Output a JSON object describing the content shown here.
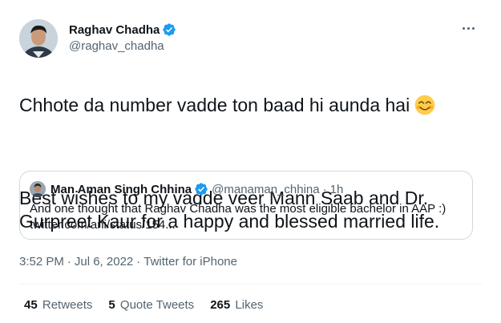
{
  "author": {
    "name": "Raghav Chadha",
    "handle": "@raghav_chadha"
  },
  "tweet": {
    "line1": "Chhote da number vadde ton baad hi aunda hai",
    "line2": "Best wishes to my vadde veer Mann Saab and Dr. Gurpreet Kaur for a happy and blessed married life."
  },
  "quote": {
    "name": "Man Aman Singh Chhina",
    "handle": "@manaman_chhina",
    "time": "1h",
    "text": "And one thought that Raghav Chadha was the most eligible bachelor in AAP :)",
    "link": "twitter.com/ani/status/154..."
  },
  "meta": {
    "time": "3:52 PM",
    "date": "Jul 6, 2022",
    "source": "Twitter for iPhone"
  },
  "stats": {
    "retweets_count": "45",
    "retweets_label": "Retweets",
    "quotes_count": "5",
    "quotes_label": "Quote Tweets",
    "likes_count": "265",
    "likes_label": "Likes"
  },
  "colors": {
    "verified": "#1d9bf0",
    "secondary_text": "#536471",
    "border": "#cfd9de"
  },
  "icons": [
    "verified-badge-icon",
    "more-options-icon",
    "smiling-face-emoji"
  ]
}
